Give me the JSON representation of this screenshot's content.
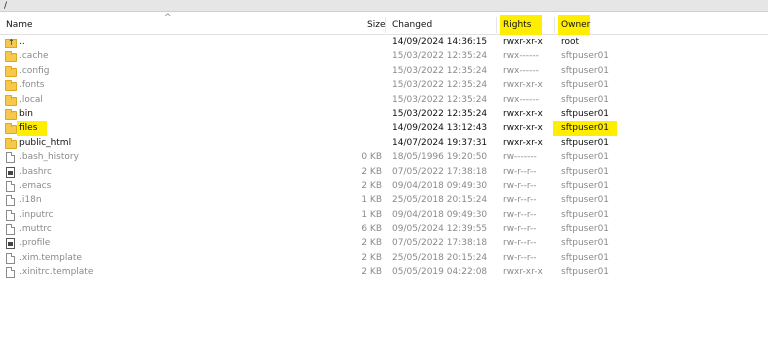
{
  "path": "/",
  "columns": {
    "name": "Name",
    "size": "Size",
    "changed": "Changed",
    "rights": "Rights",
    "owner": "Owner"
  },
  "highlight_color": "#ffee00",
  "rows": [
    {
      "name": "..",
      "size": "",
      "changed": "14/09/2024 14:36:15",
      "rights": "rwxr-xr-x",
      "owner": "root",
      "icon": "updir-icon",
      "dim": false,
      "hl_name": false,
      "hl_owner": false
    },
    {
      "name": ".cache",
      "size": "",
      "changed": "15/03/2022 12:35:24",
      "rights": "rwx------",
      "owner": "sftpuser01",
      "icon": "folder-icon",
      "dim": true,
      "hl_name": false,
      "hl_owner": false
    },
    {
      "name": ".config",
      "size": "",
      "changed": "15/03/2022 12:35:24",
      "rights": "rwx------",
      "owner": "sftpuser01",
      "icon": "folder-icon",
      "dim": true,
      "hl_name": false,
      "hl_owner": false
    },
    {
      "name": ".fonts",
      "size": "",
      "changed": "15/03/2022 12:35:24",
      "rights": "rwxr-xr-x",
      "owner": "sftpuser01",
      "icon": "folder-icon",
      "dim": true,
      "hl_name": false,
      "hl_owner": false
    },
    {
      "name": ".local",
      "size": "",
      "changed": "15/03/2022 12:35:24",
      "rights": "rwx------",
      "owner": "sftpuser01",
      "icon": "folder-icon",
      "dim": true,
      "hl_name": false,
      "hl_owner": false
    },
    {
      "name": "bin",
      "size": "",
      "changed": "15/03/2022 12:35:24",
      "rights": "rwxr-xr-x",
      "owner": "sftpuser01",
      "icon": "folder-icon",
      "dim": false,
      "hl_name": false,
      "hl_owner": false
    },
    {
      "name": "files",
      "size": "",
      "changed": "14/09/2024 13:12:43",
      "rights": "rwxr-xr-x",
      "owner": "sftpuser01",
      "icon": "folder-icon",
      "dim": false,
      "hl_name": true,
      "hl_owner": true
    },
    {
      "name": "public_html",
      "size": "",
      "changed": "14/07/2024 19:37:31",
      "rights": "rwxr-xr-x",
      "owner": "sftpuser01",
      "icon": "folder-icon",
      "dim": false,
      "hl_name": false,
      "hl_owner": false
    },
    {
      "name": ".bash_history",
      "size": "0 KB",
      "changed": "18/05/1996 19:20:50",
      "rights": "rw-------",
      "owner": "sftpuser01",
      "icon": "file-icon",
      "dim": true,
      "hl_name": false,
      "hl_owner": false
    },
    {
      "name": ".bashrc",
      "size": "2 KB",
      "changed": "07/05/2022 17:38:18",
      "rights": "rw-r--r--",
      "owner": "sftpuser01",
      "icon": "script-file-icon",
      "dim": true,
      "hl_name": false,
      "hl_owner": false
    },
    {
      "name": ".emacs",
      "size": "2 KB",
      "changed": "09/04/2018 09:49:30",
      "rights": "rw-r--r--",
      "owner": "sftpuser01",
      "icon": "file-icon",
      "dim": true,
      "hl_name": false,
      "hl_owner": false
    },
    {
      "name": ".i18n",
      "size": "1 KB",
      "changed": "25/05/2018 20:15:24",
      "rights": "rw-r--r--",
      "owner": "sftpuser01",
      "icon": "file-icon",
      "dim": true,
      "hl_name": false,
      "hl_owner": false
    },
    {
      "name": ".inputrc",
      "size": "1 KB",
      "changed": "09/04/2018 09:49:30",
      "rights": "rw-r--r--",
      "owner": "sftpuser01",
      "icon": "file-icon",
      "dim": true,
      "hl_name": false,
      "hl_owner": false
    },
    {
      "name": ".muttrc",
      "size": "6 KB",
      "changed": "09/05/2024 12:39:55",
      "rights": "rw-r--r--",
      "owner": "sftpuser01",
      "icon": "file-icon",
      "dim": true,
      "hl_name": false,
      "hl_owner": false
    },
    {
      "name": ".profile",
      "size": "2 KB",
      "changed": "07/05/2022 17:38:18",
      "rights": "rw-r--r--",
      "owner": "sftpuser01",
      "icon": "script-file-icon",
      "dim": true,
      "hl_name": false,
      "hl_owner": false
    },
    {
      "name": ".xim.template",
      "size": "2 KB",
      "changed": "25/05/2018 20:15:24",
      "rights": "rw-r--r--",
      "owner": "sftpuser01",
      "icon": "file-icon",
      "dim": true,
      "hl_name": false,
      "hl_owner": false
    },
    {
      "name": ".xinitrc.template",
      "size": "2 KB",
      "changed": "05/05/2019 04:22:08",
      "rights": "rwxr-xr-x",
      "owner": "sftpuser01",
      "icon": "file-icon",
      "dim": true,
      "hl_name": false,
      "hl_owner": false
    }
  ]
}
